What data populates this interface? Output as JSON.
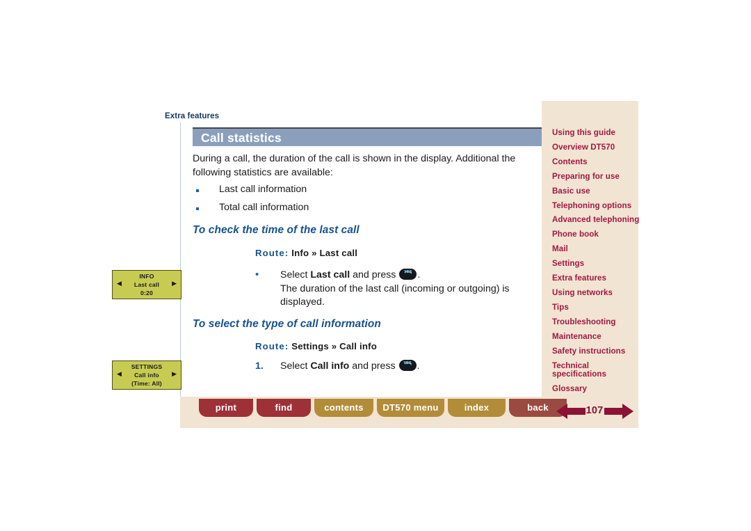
{
  "breadcrumb": "Extra features",
  "page": {
    "title": "Call statistics",
    "intro": "During a call, the duration of the call is shown in the display. Additional the following statistics are available:",
    "bullets": [
      "Last call information",
      "Total call information"
    ],
    "sections": [
      {
        "heading": "To check the time of the last call",
        "route_label": "Route:",
        "route_first": "Info",
        "route_chevron": "»",
        "route_second": "Last call",
        "step_marker": "•",
        "step_pre": "Select ",
        "step_bold": "Last call",
        "step_mid": " and press ",
        "step_post": ".",
        "step_extra": "The duration of the last call (incoming or outgoing) is displayed."
      },
      {
        "heading": "To select the type of call information",
        "route_label": "Route:",
        "route_first": "Settings",
        "route_chevron": "»",
        "route_second": "Call info",
        "step_marker": "1.",
        "step_pre": "Select ",
        "step_bold": "Call info",
        "step_mid": " and press ",
        "step_post": ".",
        "step_extra": ""
      }
    ]
  },
  "key_glyph": {
    "label": "YES",
    "name": "yes-key",
    "handset_color": "#13a8e0",
    "body_color": "#15181d"
  },
  "phone_displays": [
    {
      "name": "info-last-call-display",
      "line1": "INFO",
      "line2": "Last call",
      "line3": "0:20",
      "arrow_left": "◀",
      "arrow_right": "▶"
    },
    {
      "name": "settings-call-info-display",
      "line1": "SETTINGS",
      "line2": "Call info",
      "line3": "(Time: All)",
      "arrow_left": "◀",
      "arrow_right": "▶"
    }
  ],
  "sidebar": {
    "items": [
      {
        "label": "Using this guide",
        "two_line": false
      },
      {
        "label": "Overview DT570",
        "two_line": false
      },
      {
        "label": "Contents",
        "two_line": false
      },
      {
        "label": "Preparing for use",
        "two_line": false
      },
      {
        "label": "Basic use",
        "two_line": false
      },
      {
        "label": "Telephoning options",
        "two_line": false
      },
      {
        "label": "Advanced telephoning",
        "two_line": false
      },
      {
        "label": "Phone book",
        "two_line": false
      },
      {
        "label": "Mail",
        "two_line": false
      },
      {
        "label": "Settings",
        "two_line": false
      },
      {
        "label": "Extra features",
        "two_line": false
      },
      {
        "label": "Using networks",
        "two_line": false
      },
      {
        "label": "Tips",
        "two_line": false
      },
      {
        "label": "Troubleshooting",
        "two_line": false
      },
      {
        "label": "Maintenance",
        "two_line": false
      },
      {
        "label": "Safety instructions",
        "two_line": false
      },
      {
        "label": "Technical specifications",
        "two_line": true
      },
      {
        "label": "Glossary",
        "two_line": false
      }
    ]
  },
  "footer": {
    "buttons": [
      {
        "label": "print",
        "style": "red"
      },
      {
        "label": "find",
        "style": "red"
      },
      {
        "label": "contents",
        "style": "gold"
      },
      {
        "label": "DT570 menu",
        "style": "gold"
      },
      {
        "label": "index",
        "style": "gold"
      },
      {
        "label": "back",
        "style": "brown"
      }
    ],
    "page_number": "107"
  },
  "colors": {
    "title_bar": "#8b9fbd",
    "heading_blue": "#14528f",
    "sidebar_bg": "#f2e4d2",
    "sidebar_text": "#a11843",
    "footer_red": "#9e3038",
    "footer_gold": "#b28c38",
    "footer_brown": "#9b4a42",
    "arrow_maroon": "#8c1236",
    "lcd_green": "#c8cb52"
  }
}
